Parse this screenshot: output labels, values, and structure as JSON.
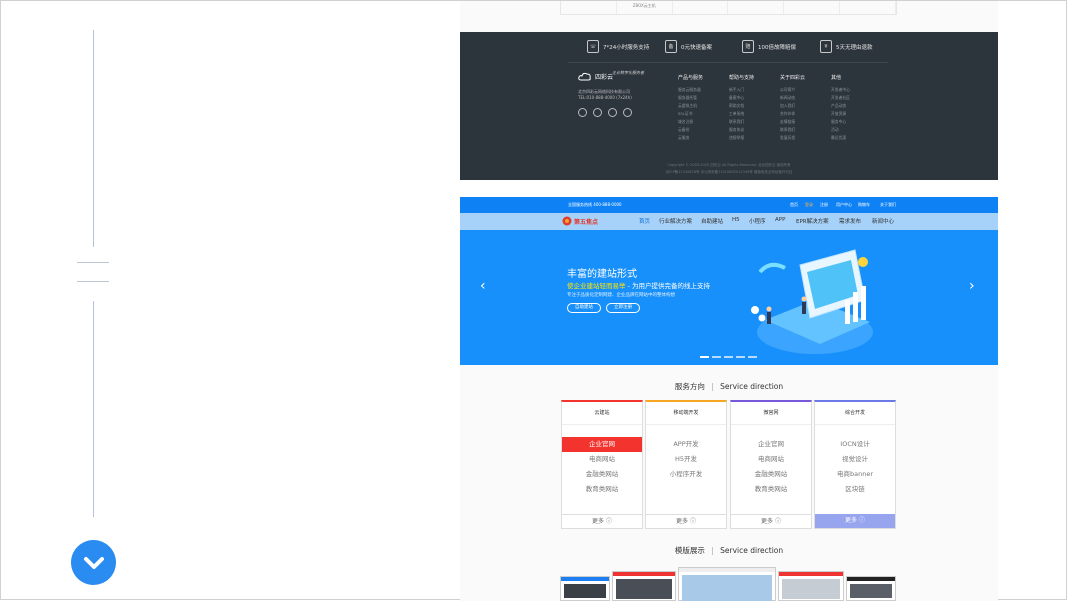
{
  "footer": {
    "features": [
      "7*24小时服务支持",
      "0元快速备案",
      "100倍故障赔偿",
      "5天无理由退款"
    ],
    "feature_icons": [
      "headset-icon",
      "record-icon",
      "compensation-icon",
      "refund-icon"
    ],
    "feature_icon_glyphs": [
      "☏",
      "备",
      "赔",
      "¥"
    ],
    "logo_text": "四彩云",
    "slogan": "企业数字化服务者",
    "company_lines": [
      "北京四彩云网络科技有限公司",
      "TEL:010-888-4000 (7x24h)"
    ],
    "columns": [
      {
        "title": "产品与服务",
        "items": [
          "服务云服务器",
          "服务器托管",
          "云虚拟主机",
          "SSL证书",
          "域名注册",
          "云备份",
          "云服务"
        ]
      },
      {
        "title": "帮助与支持",
        "items": [
          "新手入门",
          "备案中心",
          "帮助文档",
          "工单系统",
          "联系我们",
          "服务协议",
          "违规举报"
        ]
      },
      {
        "title": "关于四彩云",
        "items": [
          "公司简介",
          "新闻动态",
          "加入我们",
          "合作伙伴",
          "友情链接",
          "联系我们",
          "发展历程"
        ]
      },
      {
        "title": "其他",
        "items": [
          "开发者中心",
          "开发者社区",
          "产品动态",
          "开放资源",
          "服务中心",
          "活动",
          "最近优惠"
        ]
      }
    ],
    "copyright": "Copyright © 2005-2020 四彩云 All Rights Reserved. 北京四彩云 版权所有",
    "icp": "京ICP备12345678号 京公网安备11010802012345号 增值电信业务经营许可证"
  },
  "top_strip": {
    "cells": [
      "",
      "ZBOX云主机",
      "",
      "",
      "",
      ""
    ]
  },
  "site": {
    "topbar": {
      "left": "全国服务热线 400-888-0000",
      "links": [
        "首页",
        "登录",
        "注册",
        "用户中心",
        "购物车",
        "关于我们"
      ]
    },
    "logo_text": "第五焦点",
    "nav": [
      "首页",
      "行业解决方案",
      "自助建站",
      "H5",
      "小程序",
      "APP",
      "EPR解决方案",
      "需求发布",
      "新闻中心"
    ],
    "active_nav": 0,
    "banner": {
      "title": "丰富的建站形式",
      "subtitle_highlight": "使企业建站轻而易举",
      "subtitle_rest": " - 为用户提供完备的线上支持",
      "desc": "专注于品质化定制网建、企业品牌在网站中的整体构想",
      "btn1": "自助建站",
      "btn2": "立即注册",
      "dots": 5,
      "active_dot": 0
    },
    "services": {
      "title": "服务方向",
      "title_en": "Service direction",
      "cards": [
        {
          "header": "云建站",
          "color": "#f3332d",
          "items": [
            "企业官网",
            "电商网站",
            "金融类网站",
            "教育类网站"
          ],
          "highlight": 0,
          "more": "更多 ⓘ",
          "active": false
        },
        {
          "header": "移动端开发",
          "color": "#f5a623",
          "items": [
            "APP开发",
            "H5开发",
            "小程序开发"
          ],
          "highlight": -1,
          "more": "更多 ⓘ",
          "active": false
        },
        {
          "header": "微官网",
          "color": "#7759d9",
          "items": [
            "企业官网",
            "电商网站",
            "金融类网站",
            "教育类网站"
          ],
          "highlight": -1,
          "more": "更多 ⓘ",
          "active": false
        },
        {
          "header": "综合开发",
          "color": "#6c7ae6",
          "items": [
            "IOCN设计",
            "视觉设计",
            "电商banner",
            "区块链"
          ],
          "highlight": -1,
          "more": "更多 ⓘ",
          "active": true
        }
      ]
    },
    "templates": {
      "title": "模版展示",
      "title_en": "Service direction"
    }
  }
}
